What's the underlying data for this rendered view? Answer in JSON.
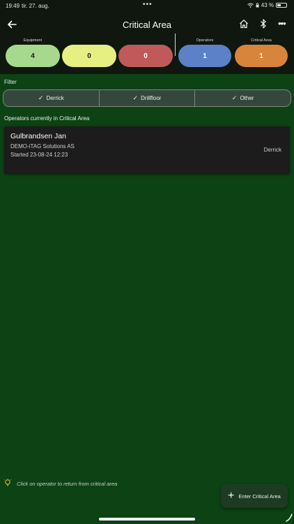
{
  "status_bar": {
    "time": "19:49",
    "date": "tir. 27. aug.",
    "dots": "•••",
    "battery": "43 %",
    "battery_level": 0.43
  },
  "header": {
    "title": "Critical Area",
    "icons": [
      "back-arrow-icon",
      "home-icon",
      "bluetooth-icon",
      "more-icon"
    ]
  },
  "summary": {
    "equipment_label": "Equipment",
    "operators_label": "Operators",
    "critical_label": "Critical Area",
    "equipment_green": "4",
    "equipment_yellow": "0",
    "equipment_red": "0",
    "operators": "1",
    "critical_area": "1"
  },
  "colors": {
    "green": "#a6d98e",
    "yellow": "#e6ef82",
    "red": "#c05a5a",
    "blue": "#5c81c9",
    "orange": "#d8843a",
    "background": "#0c4214"
  },
  "filter": {
    "label": "Filter",
    "options": [
      {
        "label": "Derrick",
        "checked": true
      },
      {
        "label": "Drillfloor",
        "checked": true
      },
      {
        "label": "Other",
        "checked": true
      }
    ]
  },
  "operators_section": {
    "title": "Operators currently in Critical Area",
    "items": [
      {
        "name": "Gulbrandsen Jan",
        "company": "DEMO-iTAG Solutions AS",
        "started": "Started 23-08-24 12:23",
        "area": "Derrick"
      }
    ]
  },
  "footer": {
    "hint": "Click on operator to return from critical area",
    "fab_label": "Enter Critical Area",
    "fab_icon": "+"
  }
}
